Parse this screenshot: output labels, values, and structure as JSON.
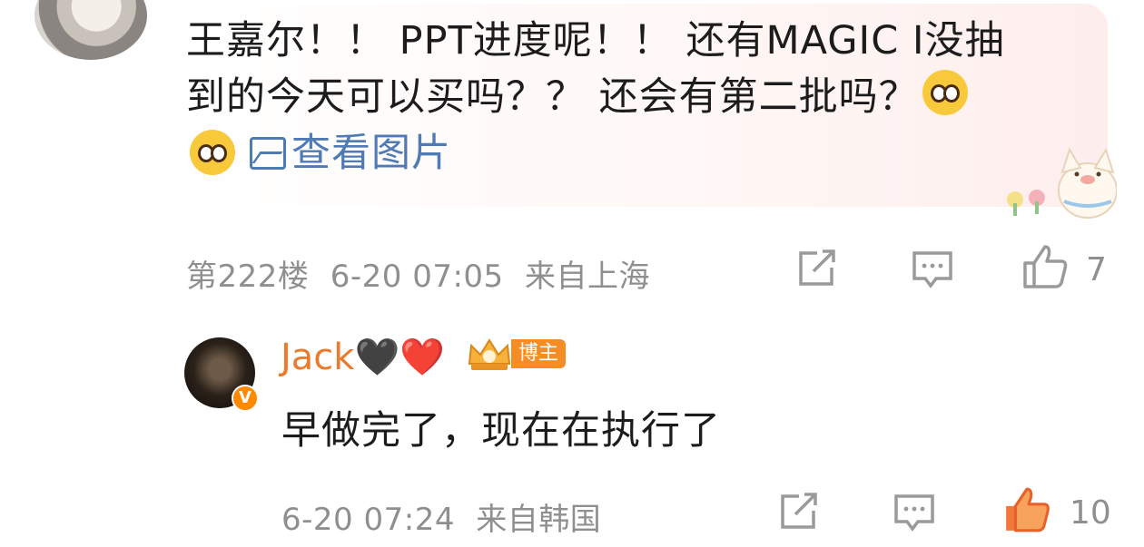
{
  "main_comment": {
    "text_line1": "王嘉尔！！ PPT进度呢！！ 还有MAGIC I没抽",
    "text_line2": "到的今天可以买吗？？ 还会有第二批吗？",
    "view_image_label": "查看图片",
    "floor": "第222楼",
    "time": "6-20 07:05",
    "location": "来自上海",
    "like_count": "7"
  },
  "reply": {
    "username": "Jack",
    "hearts": "🖤❤️",
    "badge_label": "博主",
    "verified_mark": "V",
    "text": "早做完了，现在在执行了",
    "time": "6-20 07:24",
    "location": "来自韩国",
    "like_count": "10",
    "liked": true
  },
  "colors": {
    "accent_orange": "#ea7b2c",
    "link_blue": "#4e7ab6",
    "meta_gray": "#8f8f8f"
  },
  "icons": [
    "share-icon",
    "comment-icon",
    "like-icon",
    "image-icon",
    "crying-face-emoji",
    "cat-sticker"
  ]
}
